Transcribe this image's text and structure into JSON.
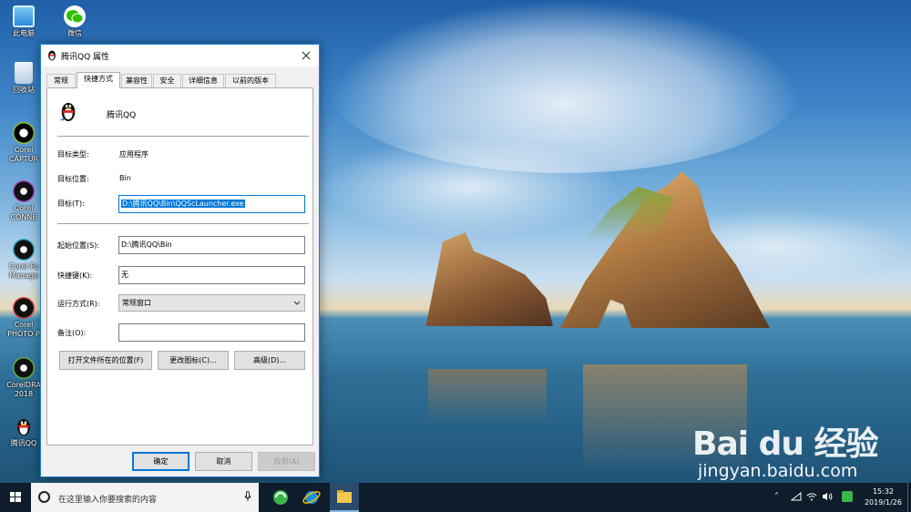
{
  "desktop": {
    "icons": [
      {
        "label": "此电脑"
      },
      {
        "label": "微信"
      },
      {
        "label": "回收站"
      },
      {
        "label": "Corel CAPTUR"
      },
      {
        "label": "Corel CONNE"
      },
      {
        "label": "Corel Fo Manage"
      },
      {
        "label": "Corel PHOTO P"
      },
      {
        "label": "CorelDRA 2018"
      },
      {
        "label": "腾讯QQ"
      }
    ]
  },
  "dialog": {
    "title": "腾讯QQ 属性",
    "tabs": [
      "常规",
      "快捷方式",
      "兼容性",
      "安全",
      "详细信息",
      "以前的版本"
    ],
    "active_tab": "快捷方式",
    "app_name": "腾讯QQ",
    "target_type_label": "目标类型:",
    "target_type_value": "应用程序",
    "target_location_label": "目标位置:",
    "target_location_value": "Bin",
    "target_label": "目标(T):",
    "target_value": "D:\\腾讯QQ\\Bin\\QQScLauncher.exe",
    "start_in_label": "起始位置(S):",
    "start_in_value": "D:\\腾讯QQ\\Bin",
    "shortcut_key_label": "快捷键(K):",
    "shortcut_key_value": "无",
    "run_label": "运行方式(R):",
    "run_value": "常规窗口",
    "comment_label": "备注(O):",
    "comment_value": "",
    "open_location_btn": "打开文件所在的位置(F)",
    "change_icon_btn": "更改图标(C)...",
    "advanced_btn": "高级(D)...",
    "ok_btn": "确定",
    "cancel_btn": "取消",
    "apply_btn": "应用(A)"
  },
  "taskbar": {
    "search_placeholder": "在这里输入你要搜索的内容",
    "time": "15:32",
    "date": "2019/1/26"
  },
  "watermark": {
    "brand": "Bai du 经验",
    "url": "jingyan.baidu.com"
  },
  "colors": {
    "accent": "#0078d7",
    "taskbar": "#0f1c2b"
  }
}
